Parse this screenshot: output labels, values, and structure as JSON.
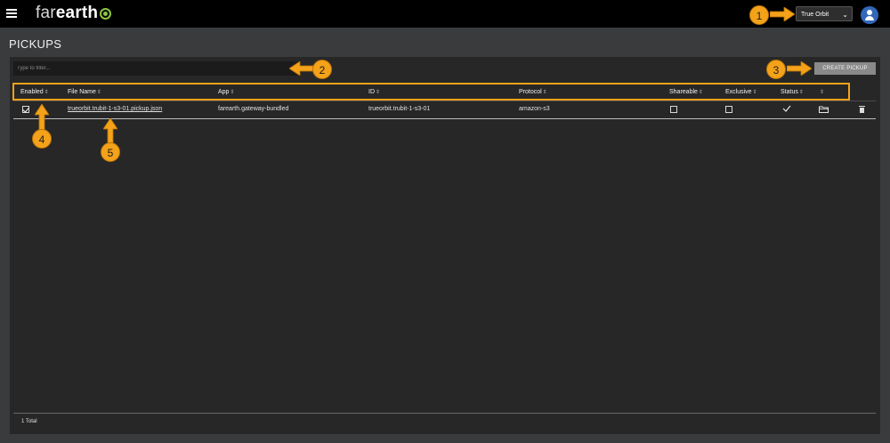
{
  "app": {
    "logo_light": "far",
    "logo_bold": "earth"
  },
  "header": {
    "org_select_value": "True Orbit",
    "select_chevron": "⌄"
  },
  "page": {
    "title": "PICKUPS"
  },
  "toolbar": {
    "filter_placeholder": "Type to filter...",
    "create_label": "CREATE PICKUP"
  },
  "table": {
    "sort_glyph": "⇕",
    "columns": [
      "Enabled",
      "File Name",
      "App",
      "ID",
      "Protocol",
      "Shareable",
      "Exclusive",
      "Status",
      ""
    ],
    "rows": [
      {
        "enabled": true,
        "file_name": "trueorbit.trubit-1-s3-01.pickup.json",
        "app": "farearth.gateway-bundled",
        "id": "trueorbit.trubit-1-s3-01",
        "protocol": "amazon-s3",
        "shareable": false,
        "exclusive": false,
        "status": "check"
      }
    ]
  },
  "footer": {
    "total": "1 Total"
  },
  "annotations": {
    "accent": "#f3a21a",
    "badges": [
      "1",
      "2",
      "3",
      "4",
      "5"
    ]
  }
}
